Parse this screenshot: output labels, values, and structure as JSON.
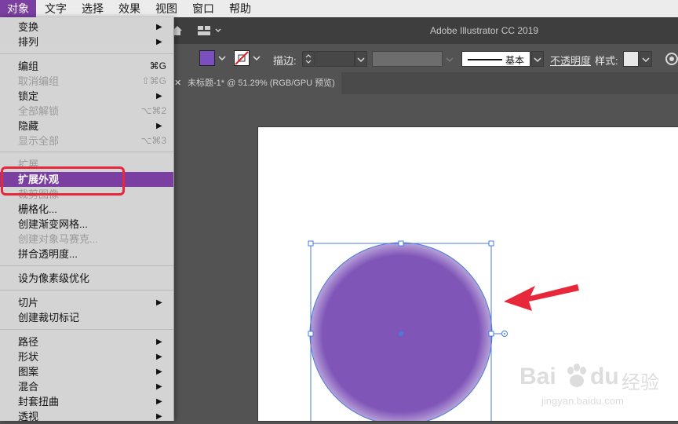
{
  "menubar": {
    "items": [
      "对象",
      "文字",
      "选择",
      "效果",
      "视图",
      "窗口",
      "帮助"
    ],
    "active_index": 0
  },
  "app_title": "Adobe Illustrator CC 2019",
  "control_bar": {
    "stroke_label": "描边:",
    "stroke_style": "基本",
    "opacity_label": "不透明度",
    "style_label": "样式:"
  },
  "document_tab": {
    "title": "未标题-1* @ 51.29% (RGB/GPU 预览)",
    "close": "✕"
  },
  "object_menu": {
    "items": [
      {
        "label": "变换",
        "submenu": true,
        "enabled": true
      },
      {
        "label": "排列",
        "submenu": true,
        "enabled": true
      },
      {
        "label": "编组",
        "shortcut": "⌘G",
        "enabled": true
      },
      {
        "label": "取消编组",
        "shortcut": "⇧⌘G",
        "enabled": false
      },
      {
        "label": "锁定",
        "submenu": true,
        "enabled": true
      },
      {
        "label": "全部解锁",
        "shortcut": "⌥⌘2",
        "enabled": false
      },
      {
        "label": "隐藏",
        "submenu": true,
        "enabled": true
      },
      {
        "label": "显示全部",
        "shortcut": "⌥⌘3",
        "enabled": false
      },
      {
        "label": "扩展...",
        "enabled": false
      },
      {
        "label": "扩展外观",
        "enabled": true,
        "highlighted": true
      },
      {
        "label": "裁剪图像",
        "enabled": false
      },
      {
        "label": "栅格化...",
        "enabled": true
      },
      {
        "label": "创建渐变网格...",
        "enabled": true
      },
      {
        "label": "创建对象马赛克...",
        "enabled": false
      },
      {
        "label": "拼合透明度...",
        "enabled": true
      },
      {
        "label": "设为像素级优化",
        "enabled": true
      },
      {
        "label": "切片",
        "submenu": true,
        "enabled": true
      },
      {
        "label": "创建裁切标记",
        "enabled": true
      },
      {
        "label": "路径",
        "submenu": true,
        "enabled": true
      },
      {
        "label": "形状",
        "submenu": true,
        "enabled": true
      },
      {
        "label": "图案",
        "submenu": true,
        "enabled": true
      },
      {
        "label": "混合",
        "submenu": true,
        "enabled": true
      },
      {
        "label": "封套扭曲",
        "submenu": true,
        "enabled": true
      },
      {
        "label": "透视",
        "submenu": true,
        "enabled": true
      }
    ]
  },
  "watermark": {
    "brand": "Bai",
    "brand2": "du",
    "suffix": "经验",
    "url": "jingyan.baidu.com"
  },
  "colors": {
    "menu_highlight": "#7a3fa0",
    "circle_fill": "#8055b8",
    "selection": "#4a7bd8",
    "annotation_red": "#e8283a",
    "fill_swatch": "#7b4fc0"
  },
  "icons": [
    "home-icon",
    "arrange-documents-icon",
    "chevron-down-icon",
    "close-icon",
    "submenu-arrow-icon",
    "recolor-icon"
  ]
}
